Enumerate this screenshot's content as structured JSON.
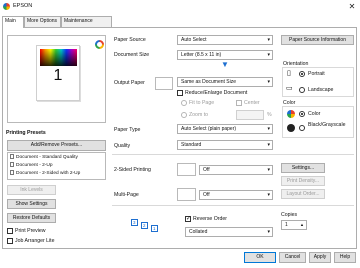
{
  "window": {
    "title": "EPSON",
    "close_glyph": "✕"
  },
  "tabs": [
    {
      "label": "Main",
      "active": true
    },
    {
      "label": "More Options",
      "active": false
    },
    {
      "label": "Maintenance",
      "active": false
    }
  ],
  "preview": {
    "copy_number": "1",
    "icon": "epson-status-icon"
  },
  "left": {
    "printing_presets_label": "Printing Presets",
    "add_remove_presets_button": "Add/Remove Presets...",
    "presets": [
      "Document - Standard Quality",
      "Document - 2-Up",
      "Document - 2-Sided with 2-Up"
    ],
    "ink_levels_button": "Ink Levels",
    "show_settings_button": "Show Settings",
    "restore_defaults_button": "Restore Defaults",
    "print_preview_label": "Print Preview",
    "job_arranger_lite_label": "Job Arranger Lite"
  },
  "settings": {
    "paper_source_label": "Paper Source",
    "paper_source_value": "Auto Select",
    "paper_source_info_button": "Paper Source Information",
    "document_size_label": "Document Size",
    "document_size_value": "Letter (8.5 x 11 in)",
    "output_paper_label": "Output Paper",
    "output_paper_value": "Same as Document Size",
    "reduce_enlarge_label": "Reduce/Enlarge Document",
    "fit_to_page_label": "Fit to Page",
    "zoom_to_label": "Zoom to",
    "center_label": "Center",
    "zoom_unit": "%",
    "paper_type_label": "Paper Type",
    "paper_type_value": "Auto Select (plain paper)",
    "quality_label": "Quality",
    "quality_value": "Standard",
    "two_sided_label": "2-Sided Printing",
    "two_sided_value": "Off",
    "two_sided_settings_button": "Settings...",
    "print_density_button": "Print Density...",
    "multi_page_label": "Multi-Page",
    "multi_page_value": "Off",
    "layout_order_button": "Layout Order...",
    "reverse_order_label": "Reverse Order",
    "collated_value": "Collated",
    "copies_label": "Copies",
    "copies_value": "1"
  },
  "orientation": {
    "label": "Orientation",
    "portrait_label": "Portrait",
    "landscape_label": "Landscape",
    "selected": "Portrait"
  },
  "color": {
    "label": "Color",
    "color_label": "Color",
    "bw_label_line1": "Black/Grayscale",
    "selected": "Color"
  },
  "footer": {
    "ok_button": "OK",
    "cancel_button": "Cancel",
    "apply_button": "Apply",
    "help_button": "Help"
  }
}
